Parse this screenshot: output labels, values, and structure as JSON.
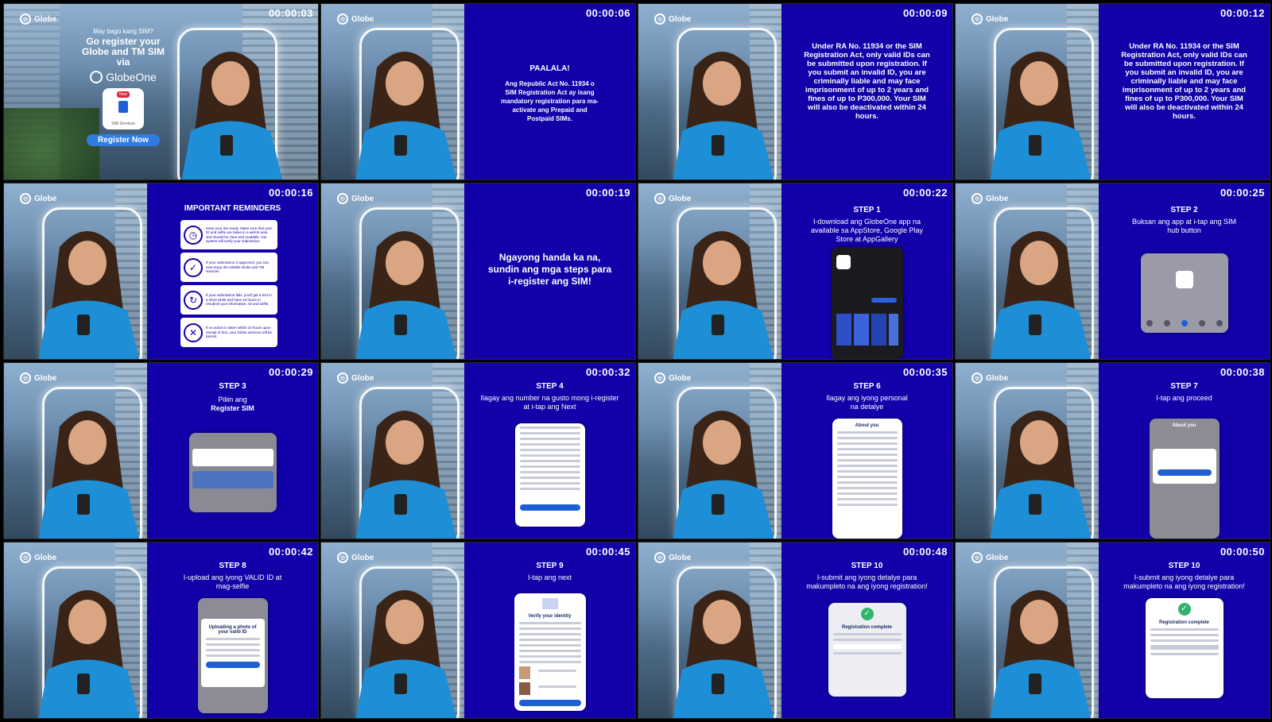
{
  "frames": [
    {
      "time": "00:00:03",
      "brand": "Globe",
      "intro_q": "May bago kang SIM?",
      "intro_head": "Go register your Globe and TM SIM via",
      "app": "GlobeOne",
      "sim_services": "SIM Services",
      "badge": "New",
      "cta": "Register Now"
    },
    {
      "time": "00:00:06",
      "brand": "Globe",
      "head": "PAALALA!",
      "body": "Ang Republic Act No. 11934 o SIM Registration Act ay isang mandatory registration para ma-activate ang Prepaid and Postpaid SIMs."
    },
    {
      "time": "00:00:09",
      "brand": "Globe",
      "body": "Under RA No. 11934 or the SIM Registration Act, only valid IDs can be submitted upon registration. If you submit an invalid ID, you are criminally liable and may face imprisonment of up to 2 years and fines of up to P300,000. Your SIM will also be deactivated within 24 hours."
    },
    {
      "time": "00:00:12",
      "brand": "Globe",
      "body": "Under RA No. 11934 or the SIM Registration Act, only valid IDs can be submitted upon registration. If you submit an invalid ID, you are criminally liable and may face imprisonment of up to 2 years and fines of up to P300,000. Your SIM will also be deactivated within 24 hours."
    },
    {
      "time": "00:00:16",
      "brand": "Globe",
      "head": "IMPORTANT REMINDERS",
      "reminders": [
        "Have your IDs ready. Make sure that your ID and selfie are taken in a well-lit area and should be clear and readable. Our system will verify your submission.",
        "If your submission is approved, you can now enjoy the reliable Globe and TM services.",
        "If your submission fails, you'll get a text in a short while and have 24 hours to resubmit your information, ID and selfie.",
        "If no action is taken within 24 hours upon receipt of text, your Globe services will be barred."
      ]
    },
    {
      "time": "00:00:19",
      "brand": "Globe",
      "body": "Ngayong handa ka na, sundin ang mga steps para i-register ang SIM!"
    },
    {
      "time": "00:00:22",
      "brand": "Globe",
      "step": "STEP 1",
      "body": "I-download ang GlobeOne app na available sa AppStore, Google Play Store at AppGallery"
    },
    {
      "time": "00:00:25",
      "brand": "Globe",
      "step": "STEP 2",
      "body": "Buksan ang app at i-tap ang SIM hub button"
    },
    {
      "time": "00:00:29",
      "brand": "Globe",
      "step": "STEP 3",
      "body": "Piliin ang",
      "body2": "Register SIM"
    },
    {
      "time": "00:00:32",
      "brand": "Globe",
      "step": "STEP 4",
      "body": "Ilagay ang number na gusto mong i-register at i-tap ang Next"
    },
    {
      "time": "00:00:35",
      "brand": "Globe",
      "step": "STEP 6",
      "body": "Ilagay ang iyong personal na detalye",
      "mock_title": "About you"
    },
    {
      "time": "00:00:38",
      "brand": "Globe",
      "step": "STEP 7",
      "body": "I-tap ang proceed",
      "mock_title": "About you"
    },
    {
      "time": "00:00:42",
      "brand": "Globe",
      "step": "STEP 8",
      "body": "I-upload ang iyong VALID ID at mag-selfie",
      "mock_title": "Uploading a photo of your valid ID"
    },
    {
      "time": "00:00:45",
      "brand": "Globe",
      "step": "STEP 9",
      "body": "I-tap ang next",
      "mock_title": "Verify your identity"
    },
    {
      "time": "00:00:48",
      "brand": "Globe",
      "step": "STEP 10",
      "body": "I-submit ang iyong detalye para makumpleto na ang iyong registration!",
      "mock_title": "Registration complete"
    },
    {
      "time": "00:00:50",
      "brand": "Globe",
      "step": "STEP 10",
      "body": "I-submit ang iyong detalye para makumpleto na ang iyong registration!",
      "mock_title": "Registration complete"
    }
  ],
  "colors": {
    "panel": "#1200a8",
    "cta": "#2f7de1"
  }
}
